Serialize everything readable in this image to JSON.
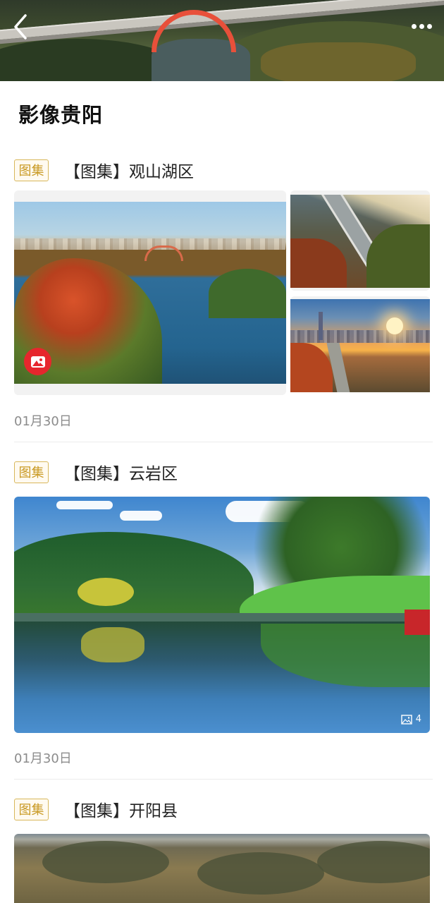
{
  "page": {
    "title": "影像贵阳"
  },
  "nav": {
    "back_icon": "chevron-left-icon",
    "more_icon": "more-dots-icon"
  },
  "articles": [
    {
      "tag": "图集",
      "title": "【图集】观山湖区",
      "date": "01月30日",
      "layout": "grid-3"
    },
    {
      "tag": "图集",
      "title": "【图集】云岩区",
      "date": "01月30日",
      "layout": "single",
      "image_count": "4"
    },
    {
      "tag": "图集",
      "title": "【图集】开阳县",
      "layout": "single"
    }
  ],
  "colors": {
    "tag_border": "#d8b75a",
    "tag_text": "#c99a24",
    "badge_red": "#e6262d",
    "date_gray": "#8c8c8c"
  }
}
